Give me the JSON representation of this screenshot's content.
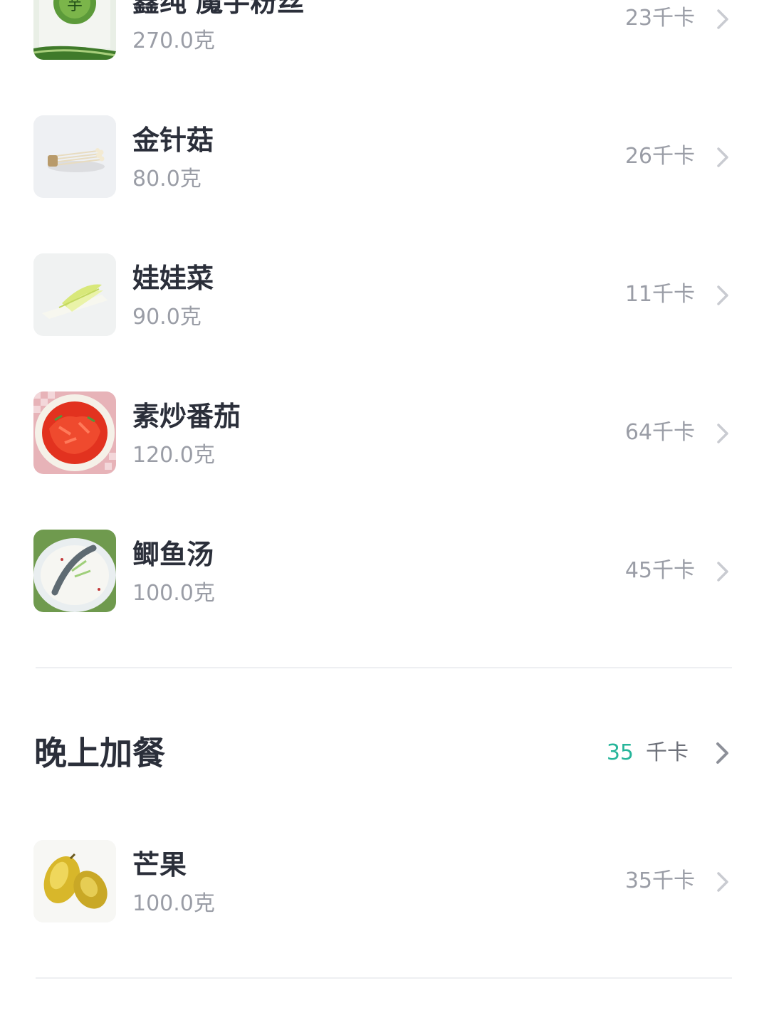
{
  "meals": [
    {
      "items": [
        {
          "name": "鑫纯 魔芋粉丝",
          "weight": "270.0克",
          "kcal": "23千卡",
          "image": "konjac-noodles-package"
        },
        {
          "name": "金针菇",
          "weight": "80.0克",
          "kcal": "26千卡",
          "image": "enoki-mushroom"
        },
        {
          "name": "娃娃菜",
          "weight": "90.0克",
          "kcal": "11千卡",
          "image": "baby-cabbage"
        },
        {
          "name": "素炒番茄",
          "weight": "120.0克",
          "kcal": "64千卡",
          "image": "stir-fried-tomato"
        },
        {
          "name": "鲫鱼汤",
          "weight": "100.0克",
          "kcal": "45千卡",
          "image": "crucian-fish-soup"
        }
      ]
    },
    {
      "title": "晚上加餐",
      "total_kcal": "35",
      "unit": "千卡",
      "items": [
        {
          "name": "芒果",
          "weight": "100.0克",
          "kcal": "35千卡",
          "image": "mango"
        }
      ]
    }
  ],
  "colors": {
    "accent": "#26b59a",
    "text_primary": "#2b2f3a",
    "text_secondary": "#9a9da6",
    "divider": "#eeeff2",
    "chevron": "#c9cbd1"
  },
  "icons": {
    "row_arrow": "chevron-right-icon",
    "header_arrow": "chevron-right-icon"
  }
}
